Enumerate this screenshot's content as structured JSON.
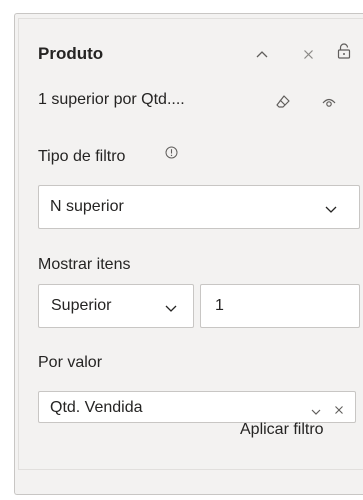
{
  "card": {
    "title": "Produto",
    "summary": "1 superior por Qtd....",
    "filter_type": {
      "label": "Tipo de filtro",
      "value": "N superior"
    },
    "show_items": {
      "label": "Mostrar itens",
      "direction": "Superior",
      "count": "1"
    },
    "by_value": {
      "label": "Por valor",
      "field": "Qtd. Vendida"
    },
    "apply_label": "Aplicar filtro"
  },
  "icons": {
    "collapse": "chevron-up-icon",
    "close": "close-icon",
    "lock": "lock-icon",
    "clear": "eraser-icon",
    "visibility": "eye-icon",
    "info": "info-icon",
    "dropdown": "chevron-down-icon"
  }
}
